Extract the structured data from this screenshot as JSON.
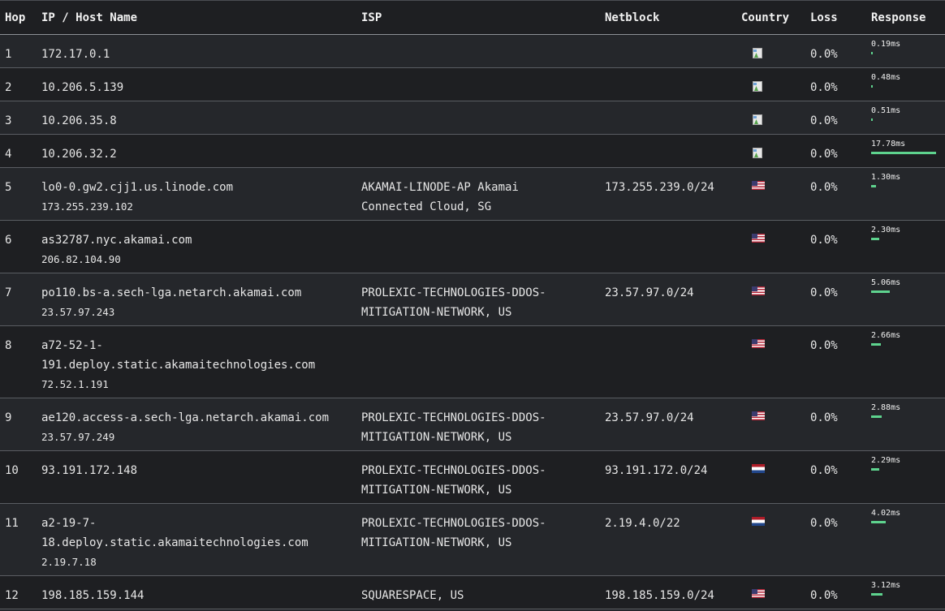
{
  "headers": {
    "hop": "Hop",
    "host": "IP / Host Name",
    "isp": "ISP",
    "netblock": "Netblock",
    "country": "Country",
    "loss": "Loss",
    "response": "Response"
  },
  "colors": {
    "bar": "#5ed38e",
    "row_a": "#25272b",
    "row_b": "#1e1f22"
  },
  "rows": [
    {
      "hop": "1",
      "host_lines": [
        "172.17.0.1"
      ],
      "ip": "",
      "isp_lines": [],
      "netblock": "",
      "country_icon": "broken-image-icon",
      "loss": "0.0%",
      "response": "0.19ms",
      "response_ms": 0.19
    },
    {
      "hop": "2",
      "host_lines": [
        "10.206.5.139"
      ],
      "ip": "",
      "isp_lines": [],
      "netblock": "",
      "country_icon": "broken-image-icon",
      "loss": "0.0%",
      "response": "0.48ms",
      "response_ms": 0.48
    },
    {
      "hop": "3",
      "host_lines": [
        "10.206.35.8"
      ],
      "ip": "",
      "isp_lines": [],
      "netblock": "",
      "country_icon": "broken-image-icon",
      "loss": "0.0%",
      "response": "0.51ms",
      "response_ms": 0.51
    },
    {
      "hop": "4",
      "host_lines": [
        "10.206.32.2"
      ],
      "ip": "",
      "isp_lines": [],
      "netblock": "",
      "country_icon": "broken-image-icon",
      "loss": "0.0%",
      "response": "17.78ms",
      "response_ms": 17.78
    },
    {
      "hop": "5",
      "host_lines": [
        "lo0-0.gw2.cjj1.us.linode.com"
      ],
      "ip": "173.255.239.102",
      "isp_lines": [
        "AKAMAI-LINODE-AP Akamai",
        "Connected Cloud, SG"
      ],
      "netblock": "173.255.239.0/24",
      "country_icon": "us-flag-icon",
      "loss": "0.0%",
      "response": "1.30ms",
      "response_ms": 1.3
    },
    {
      "hop": "6",
      "host_lines": [
        "as32787.nyc.akamai.com"
      ],
      "ip": "206.82.104.90",
      "isp_lines": [],
      "netblock": "",
      "country_icon": "us-flag-icon",
      "loss": "0.0%",
      "response": "2.30ms",
      "response_ms": 2.3
    },
    {
      "hop": "7",
      "host_lines": [
        "po110.bs-a.sech-lga.netarch.akamai.com"
      ],
      "ip": "23.57.97.243",
      "isp_lines": [
        "PROLEXIC-TECHNOLOGIES-DDOS-",
        "MITIGATION-NETWORK, US"
      ],
      "netblock": "23.57.97.0/24",
      "country_icon": "us-flag-icon",
      "loss": "0.0%",
      "response": "5.06ms",
      "response_ms": 5.06
    },
    {
      "hop": "8",
      "host_lines": [
        "a72-52-1-",
        "191.deploy.static.akamaitechnologies.com"
      ],
      "ip": "72.52.1.191",
      "isp_lines": [],
      "netblock": "",
      "country_icon": "us-flag-icon",
      "loss": "0.0%",
      "response": "2.66ms",
      "response_ms": 2.66
    },
    {
      "hop": "9",
      "host_lines": [
        "ae120.access-a.sech-lga.netarch.akamai.com"
      ],
      "ip": "23.57.97.249",
      "isp_lines": [
        "PROLEXIC-TECHNOLOGIES-DDOS-",
        "MITIGATION-NETWORK, US"
      ],
      "netblock": "23.57.97.0/24",
      "country_icon": "us-flag-icon",
      "loss": "0.0%",
      "response": "2.88ms",
      "response_ms": 2.88
    },
    {
      "hop": "10",
      "host_lines": [
        "93.191.172.148"
      ],
      "ip": "",
      "isp_lines": [
        "PROLEXIC-TECHNOLOGIES-DDOS-",
        "MITIGATION-NETWORK, US"
      ],
      "netblock": "93.191.172.0/24",
      "country_icon": "nl-flag-icon",
      "loss": "0.0%",
      "response": "2.29ms",
      "response_ms": 2.29
    },
    {
      "hop": "11",
      "host_lines": [
        "a2-19-7-",
        "18.deploy.static.akamaitechnologies.com"
      ],
      "ip": "2.19.7.18",
      "isp_lines": [
        "PROLEXIC-TECHNOLOGIES-DDOS-",
        "MITIGATION-NETWORK, US"
      ],
      "netblock": "2.19.4.0/22",
      "country_icon": "nl-flag-icon",
      "loss": "0.0%",
      "response": "4.02ms",
      "response_ms": 4.02
    },
    {
      "hop": "12",
      "host_lines": [
        "198.185.159.144"
      ],
      "ip": "",
      "isp_lines": [
        "SQUARESPACE, US"
      ],
      "netblock": "198.185.159.0/24",
      "country_icon": "us-flag-icon",
      "loss": "0.0%",
      "response": "3.12ms",
      "response_ms": 3.12
    }
  ]
}
